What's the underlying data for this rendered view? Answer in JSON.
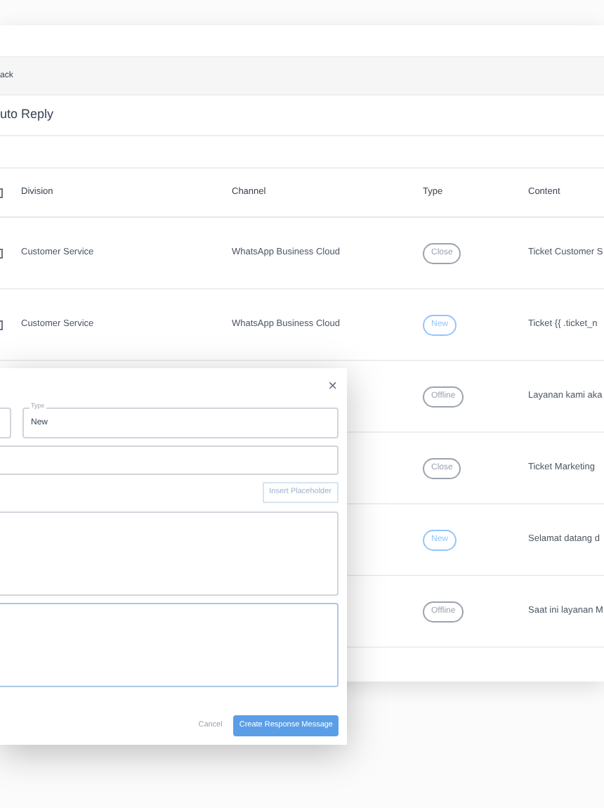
{
  "back_link": "ack",
  "page_title": "uto Reply",
  "table": {
    "all_checked": false,
    "columns": [
      "Division",
      "Channel",
      "Type",
      "Content"
    ],
    "rows": [
      {
        "checked": false,
        "division": "Customer Service",
        "channel": "WhatsApp Business Cloud",
        "type": "Close",
        "color": "#9ca3af",
        "content": "Ticket Customer S"
      },
      {
        "checked": false,
        "division": "Customer Service",
        "channel": "WhatsApp Business Cloud",
        "type": "New",
        "color": "#93c5fd",
        "content": "Ticket {{ .ticket_n"
      },
      {
        "type": "Offline",
        "color": "#9ca3af",
        "content": "Layanan kami aka"
      },
      {
        "type": "Close",
        "color": "#9ca3af",
        "content": "Ticket Marketing"
      },
      {
        "type": "New",
        "color": "#93c5fd",
        "content": "Selamat datang d"
      },
      {
        "type": "Offline",
        "color": "#9ca3af",
        "content": "Saat ini layanan M"
      }
    ]
  },
  "dialog": {
    "close": "×",
    "type_field": {
      "label": "Type",
      "value": "New"
    },
    "insert_button": "Insert Placeholder",
    "cancel": "Cancel",
    "submit": "Create Response Message"
  }
}
